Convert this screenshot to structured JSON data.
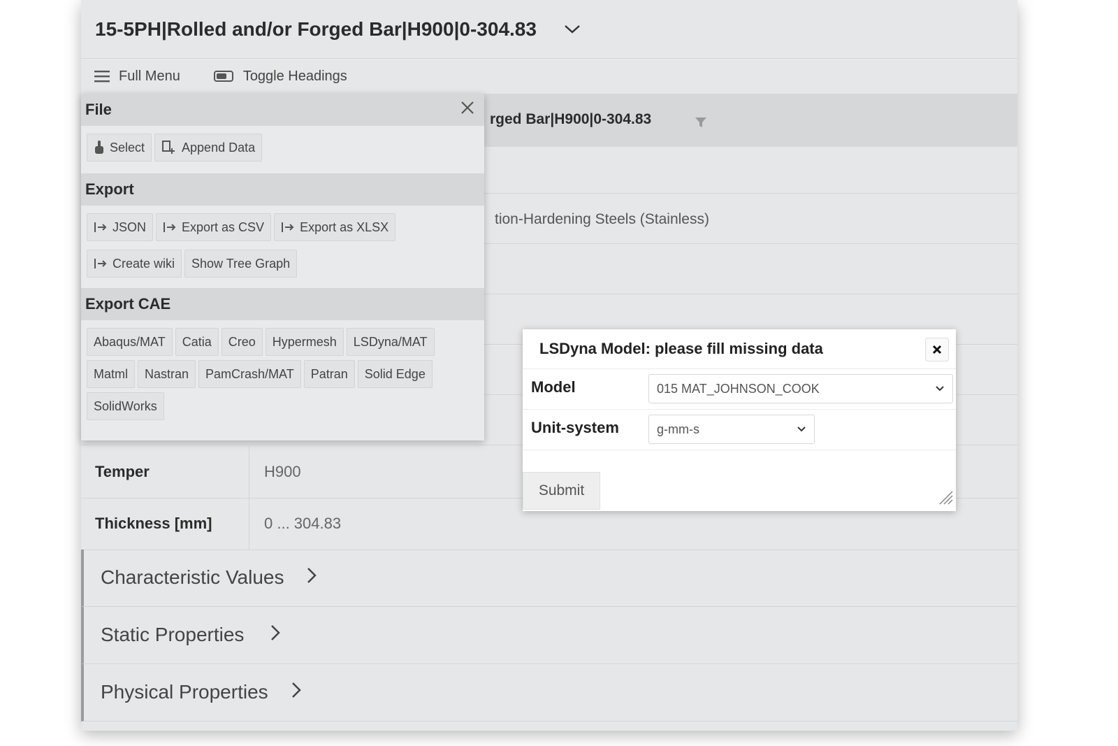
{
  "header": {
    "title": "15-5PH|Rolled and/or Forged Bar|H900|0-304.83"
  },
  "toolbar": {
    "full_menu": "Full Menu",
    "toggle_headings": "Toggle Headings"
  },
  "background": {
    "band_title": "rged Bar|H900|0-304.83",
    "classification": "tion-Hardening Steels (Stainless)",
    "properties": [
      {
        "label": "Temper",
        "value": "H900"
      },
      {
        "label": "Thickness [mm]",
        "value": "0 ... 304.83"
      }
    ],
    "sections": [
      "Characteristic Values",
      "Static Properties",
      "Physical Properties"
    ]
  },
  "menu": {
    "file": {
      "heading": "File",
      "buttons": [
        "Select",
        "Append Data"
      ]
    },
    "export": {
      "heading": "Export",
      "buttons": [
        "JSON",
        "Export as CSV",
        "Export as XLSX",
        "Create wiki",
        "Show Tree Graph"
      ]
    },
    "export_cae": {
      "heading": "Export CAE",
      "buttons": [
        "Abaqus/MAT",
        "Catia",
        "Creo",
        "Hypermesh",
        "LSDyna/MAT",
        "Matml",
        "Nastran",
        "PamCrash/MAT",
        "Patran",
        "Solid Edge",
        "SolidWorks"
      ]
    }
  },
  "dialog": {
    "title": "LSDyna Model: please fill missing data",
    "model_label": "Model",
    "model_value": "015 MAT_JOHNSON_COOK",
    "unit_label": "Unit-system",
    "unit_value": "g-mm-s",
    "submit": "Submit"
  },
  "icons": [
    "menu-icon",
    "toggle-icon",
    "chevron-down-icon",
    "close-icon",
    "filter-icon",
    "hand-pointer-icon",
    "append-icon",
    "export-icon",
    "chevron-right-icon",
    "resize-grip-icon"
  ]
}
